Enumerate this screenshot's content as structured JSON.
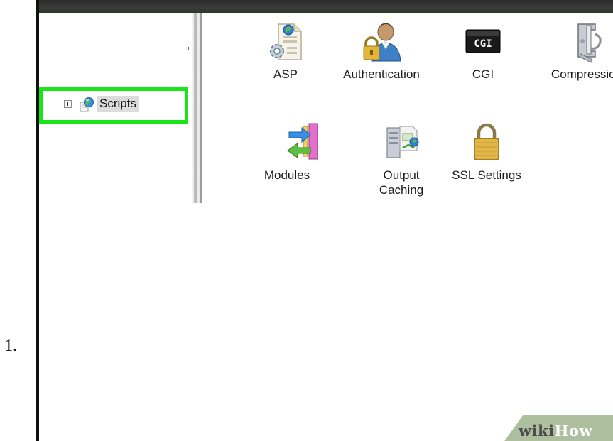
{
  "list_number": "1.",
  "tree": {
    "node_label": "Scripts",
    "highlight_color": "#19e619"
  },
  "features": [
    {
      "label": "ASP",
      "icon": "asp-page-icon"
    },
    {
      "label": "Authentication",
      "icon": "user-lock-icon"
    },
    {
      "label": "CGI",
      "icon": "cgi-icon",
      "icon_text": "CGI"
    },
    {
      "label": "Compression",
      "icon": "compression-clamp-icon"
    },
    {
      "label": "Modules",
      "icon": "modules-icon"
    },
    {
      "label": "Output\nCaching",
      "icon": "output-caching-icon"
    },
    {
      "label": "SSL Settings",
      "icon": "padlock-icon"
    }
  ],
  "watermark": {
    "part1": "wiki",
    "part2": "How"
  }
}
